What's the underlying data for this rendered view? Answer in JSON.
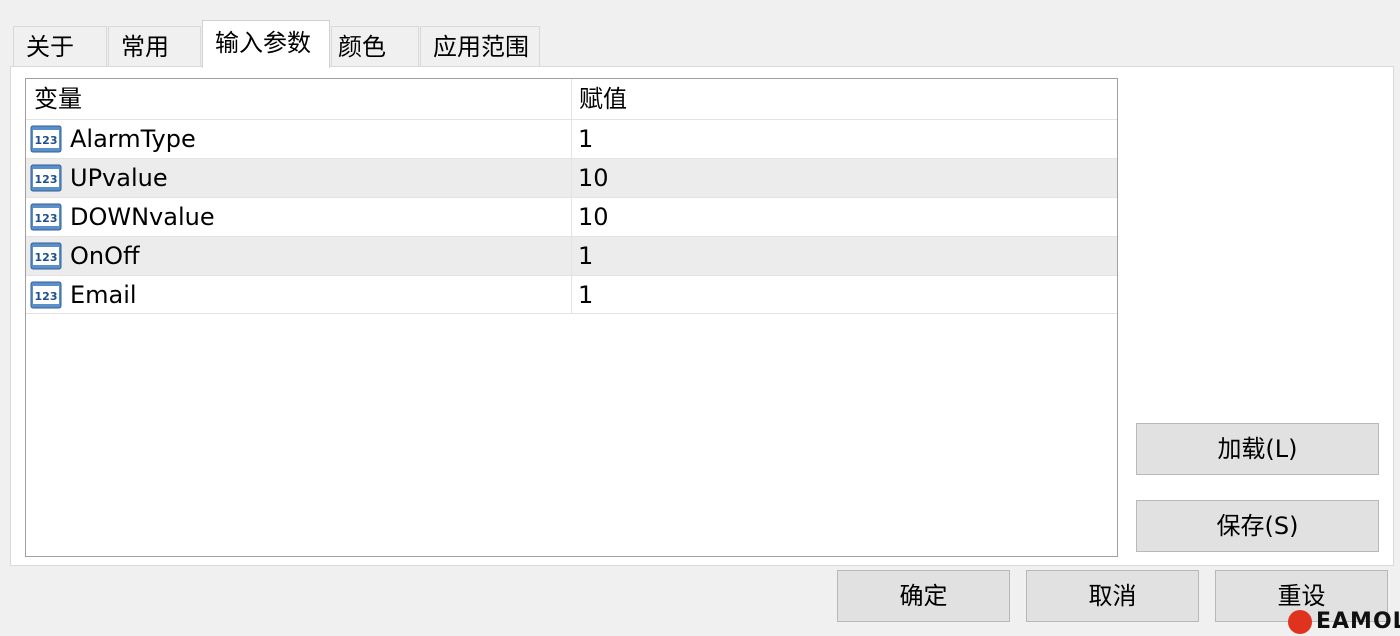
{
  "tabs": [
    {
      "label": "关于"
    },
    {
      "label": "常用"
    },
    {
      "label": "输入参数",
      "active": true
    },
    {
      "label": "颜色"
    },
    {
      "label": "应用范围"
    }
  ],
  "grid": {
    "headers": [
      "变量",
      "赋值"
    ],
    "rows": [
      {
        "name": "AlarmType",
        "value": "1",
        "icon": "numeric-123-icon"
      },
      {
        "name": "UPvalue",
        "value": "10",
        "icon": "numeric-123-icon"
      },
      {
        "name": "DOWNvalue",
        "value": "10",
        "icon": "numeric-123-icon"
      },
      {
        "name": "OnOff",
        "value": "1",
        "icon": "numeric-123-icon"
      },
      {
        "name": "Email",
        "value": "1",
        "icon": "numeric-123-icon"
      }
    ]
  },
  "side_buttons": {
    "load": "加载(L)",
    "save": "保存(S)"
  },
  "bottom_buttons": {
    "ok": "确定",
    "cancel": "取消",
    "reset": "重设"
  },
  "watermark": {
    "text": "EAMOL",
    "color": "#e0331f"
  }
}
